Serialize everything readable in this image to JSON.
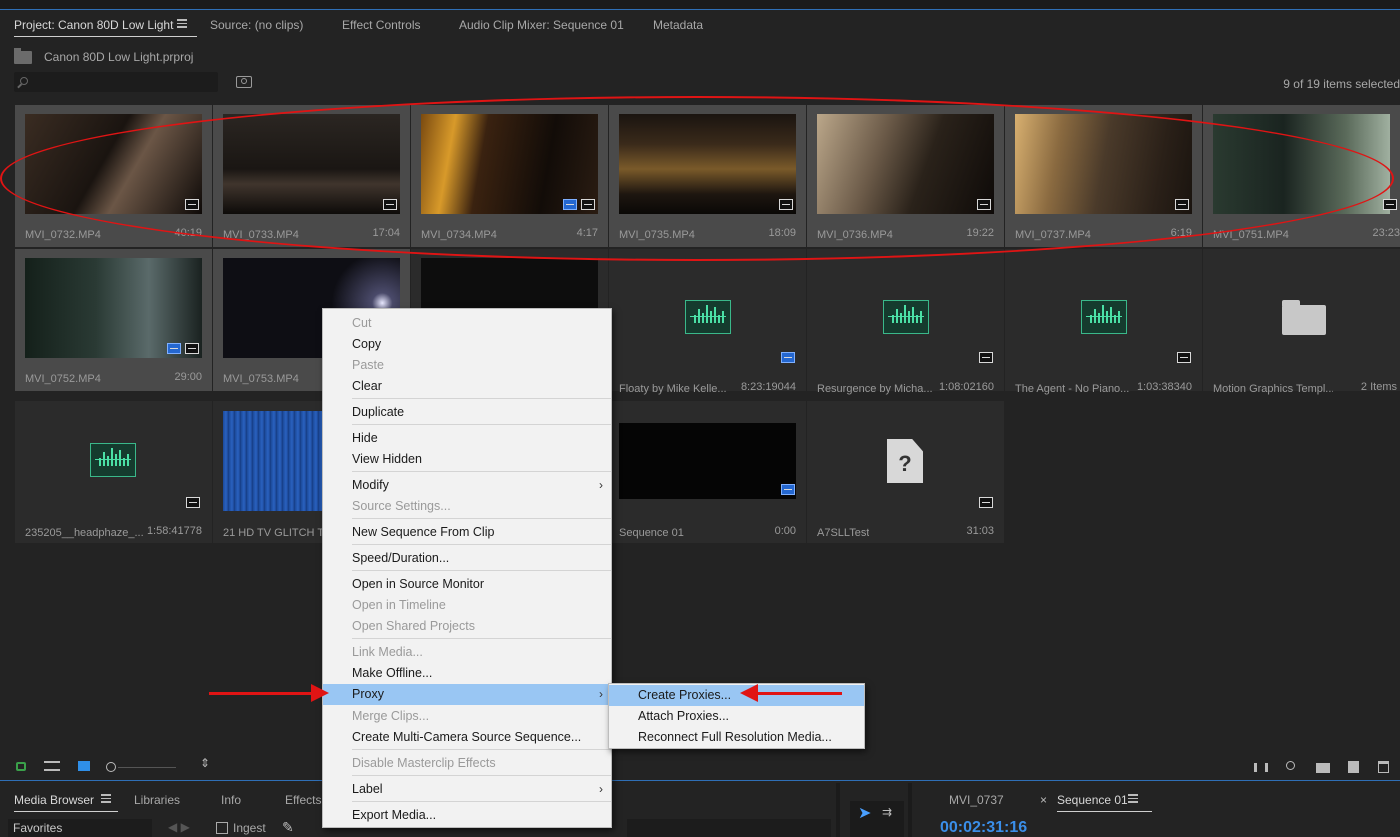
{
  "project_panel": {
    "tabs": [
      "Project: Canon 80D Low Light",
      "Source: (no clips)",
      "Effect Controls",
      "Audio Clip Mixer: Sequence 01",
      "Metadata"
    ],
    "project_file": "Canon 80D Low Light.prproj",
    "items_count": "9 of 19 items selected"
  },
  "clips": [
    {
      "name": "MVI_0732.MP4",
      "duration": "40:19"
    },
    {
      "name": "MVI_0733.MP4",
      "duration": "17:04"
    },
    {
      "name": "MVI_0734.MP4",
      "duration": "4:17"
    },
    {
      "name": "MVI_0735.MP4",
      "duration": "18:09"
    },
    {
      "name": "MVI_0736.MP4",
      "duration": "19:22"
    },
    {
      "name": "MVI_0737.MP4",
      "duration": "6:19"
    },
    {
      "name": "MVI_0751.MP4",
      "duration": "23:23"
    },
    {
      "name": "MVI_0752.MP4",
      "duration": "29:00"
    },
    {
      "name": "MVI_0753.MP4",
      "duration": ""
    },
    {
      "name": "",
      "duration": ""
    },
    {
      "name": "Floaty by Mike Kelle...",
      "duration": "8:23:19044"
    },
    {
      "name": "Resurgence by Micha...",
      "duration": "1:08:02160"
    },
    {
      "name": "The Agent - No Piano...",
      "duration": "1:03:38340"
    },
    {
      "name": "Motion Graphics Templ...",
      "duration": "2 Items"
    },
    {
      "name": "235205__headphaze_...",
      "duration": "1:58:41778"
    },
    {
      "name": "21 HD TV GLITCH TR",
      "duration": ""
    },
    {
      "name": "",
      "duration": ""
    },
    {
      "name": "Sequence 01",
      "duration": "0:00"
    },
    {
      "name": "A7SLLTest",
      "duration": "31:03"
    }
  ],
  "context_menu": {
    "cut": "Cut",
    "copy": "Copy",
    "paste": "Paste",
    "clear": "Clear",
    "duplicate": "Duplicate",
    "hide": "Hide",
    "view_hidden": "View Hidden",
    "modify": "Modify",
    "source_settings": "Source Settings...",
    "new_sequence": "New Sequence From Clip",
    "speed_duration": "Speed/Duration...",
    "open_source": "Open in Source Monitor",
    "open_timeline": "Open in Timeline",
    "open_shared": "Open Shared Projects",
    "link_media": "Link Media...",
    "make_offline": "Make Offline...",
    "proxy": "Proxy",
    "merge_clips": "Merge Clips...",
    "multicam": "Create Multi-Camera Source Sequence...",
    "disable_masterclip": "Disable Masterclip Effects",
    "label": "Label",
    "export_media": "Export Media..."
  },
  "proxy_submenu": {
    "create": "Create Proxies...",
    "attach": "Attach Proxies...",
    "reconnect": "Reconnect Full Resolution Media..."
  },
  "lower_panel": {
    "tabs": [
      "Media Browser",
      "Libraries",
      "Info",
      "Effects"
    ],
    "favorites": "Favorites",
    "ingest": "Ingest",
    "timeline_tabs": [
      "MVI_0737",
      "Sequence 01"
    ],
    "timecode": "00:02:31:16"
  },
  "colors": {
    "accent_blue": "#2f6fb6",
    "highlight": "#99c6f3",
    "annotation_red": "#e01414",
    "audio_green": "#3ab88a"
  }
}
